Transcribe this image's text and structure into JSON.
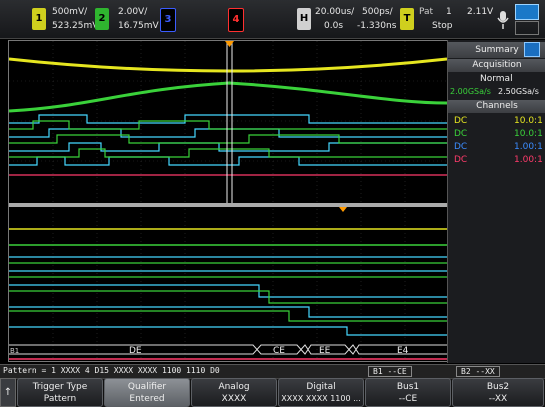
{
  "header": {
    "ch1": {
      "num": "1",
      "scale": "500mV/",
      "offset": "523.25mV",
      "color": "#e6e620"
    },
    "ch2": {
      "num": "2",
      "scale": "2.00V/",
      "offset": "16.75mV",
      "color": "#3ad13a"
    },
    "ch3": {
      "num": "3",
      "color": "#3b5cff"
    },
    "ch4": {
      "num": "4",
      "color": "#ff3030"
    },
    "horiz": {
      "badge": "H",
      "timebase": "20.00us/",
      "delay": "0.0s",
      "ref": "500ps/",
      "pos": "-1.330ns"
    },
    "trigger": {
      "badge": "T",
      "mode": "Pat",
      "source": "1",
      "level": "2.11V",
      "state": "Stop"
    }
  },
  "sidebar": {
    "tab_label": "Summary",
    "acq_header": "Acquisition",
    "acq_mode": "Normal",
    "rate1": "2.00GSa/s",
    "rate2": "2.50GSa/s",
    "ch_header": "Channels",
    "channels": [
      {
        "coupling": "DC",
        "ratio": "10.0:1",
        "color": "#e6e620"
      },
      {
        "coupling": "DC",
        "ratio": "10.0:1",
        "color": "#3ad13a"
      },
      {
        "coupling": "DC",
        "ratio": "1.00:1",
        "color": "#3b8cff"
      },
      {
        "coupling": "DC",
        "ratio": "1.00:1",
        "color": "#ff3b6b"
      }
    ]
  },
  "bus_decode": {
    "label": "B1",
    "segments": [
      "DE",
      "CE",
      "EE",
      "E4"
    ]
  },
  "status": {
    "pattern": "Pattern = 1 XXXX 4 D15 XXXX XXXX 1100 1110 D0",
    "bus1": "B1 --CE",
    "bus2": "B2 --XX"
  },
  "softkeys": [
    {
      "title": "Trigger Type",
      "value": "Pattern"
    },
    {
      "title": "Qualifier",
      "value": "Entered"
    },
    {
      "title": "Analog",
      "value": "XXXX"
    },
    {
      "title": "Digital",
      "value": "XXXX XXXX 1100 ..."
    },
    {
      "title": "Bus1",
      "value": "--CE"
    },
    {
      "title": "Bus2",
      "value": "--XX"
    }
  ],
  "colors": {
    "accent": "#00ccff",
    "ch1": "#e6e620",
    "ch2": "#3ad13a",
    "digital": "#45d8ff"
  }
}
